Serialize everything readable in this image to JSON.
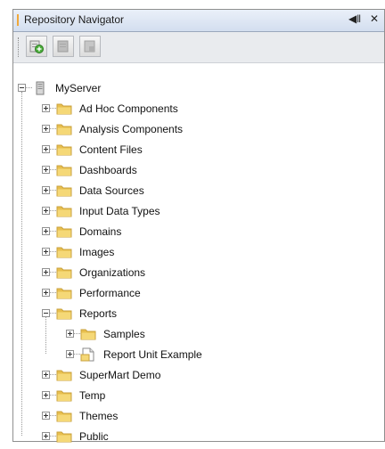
{
  "panel": {
    "title": "Repository Navigator",
    "pin_glyph": "◀‖",
    "close_glyph": "✕"
  },
  "toolbar": {
    "buttons": [
      {
        "icon": "add-resource-icon",
        "enabled": true
      },
      {
        "icon": "edit-resource-icon",
        "enabled": false
      },
      {
        "icon": "delete-resource-icon",
        "enabled": false
      }
    ]
  },
  "tree": {
    "root": {
      "label": "MyServer",
      "icon": "server-icon",
      "expanded": true
    },
    "folders": [
      {
        "label": "Ad Hoc Components",
        "expanded": false
      },
      {
        "label": "Analysis Components",
        "expanded": false
      },
      {
        "label": "Content Files",
        "expanded": false
      },
      {
        "label": "Dashboards",
        "expanded": false
      },
      {
        "label": "Data Sources",
        "expanded": false
      },
      {
        "label": "Input Data Types",
        "expanded": false
      },
      {
        "label": "Domains",
        "expanded": false
      },
      {
        "label": "Images",
        "expanded": false
      },
      {
        "label": "Organizations",
        "expanded": false
      },
      {
        "label": "Performance",
        "expanded": false
      },
      {
        "label": "Reports",
        "expanded": true,
        "children": [
          {
            "label": "Samples",
            "icon": "folder-icon"
          },
          {
            "label": "Report Unit Example",
            "icon": "report-unit-icon"
          }
        ]
      },
      {
        "label": "SuperMart Demo",
        "expanded": false
      },
      {
        "label": "Temp",
        "expanded": false
      },
      {
        "label": "Themes",
        "expanded": false
      },
      {
        "label": "Public",
        "expanded": false
      }
    ]
  },
  "colors": {
    "folder_fill": "#f5d877",
    "folder_tab": "#e8bf4e",
    "title_bar": "#d3deef",
    "accent": "#f0a83a"
  }
}
